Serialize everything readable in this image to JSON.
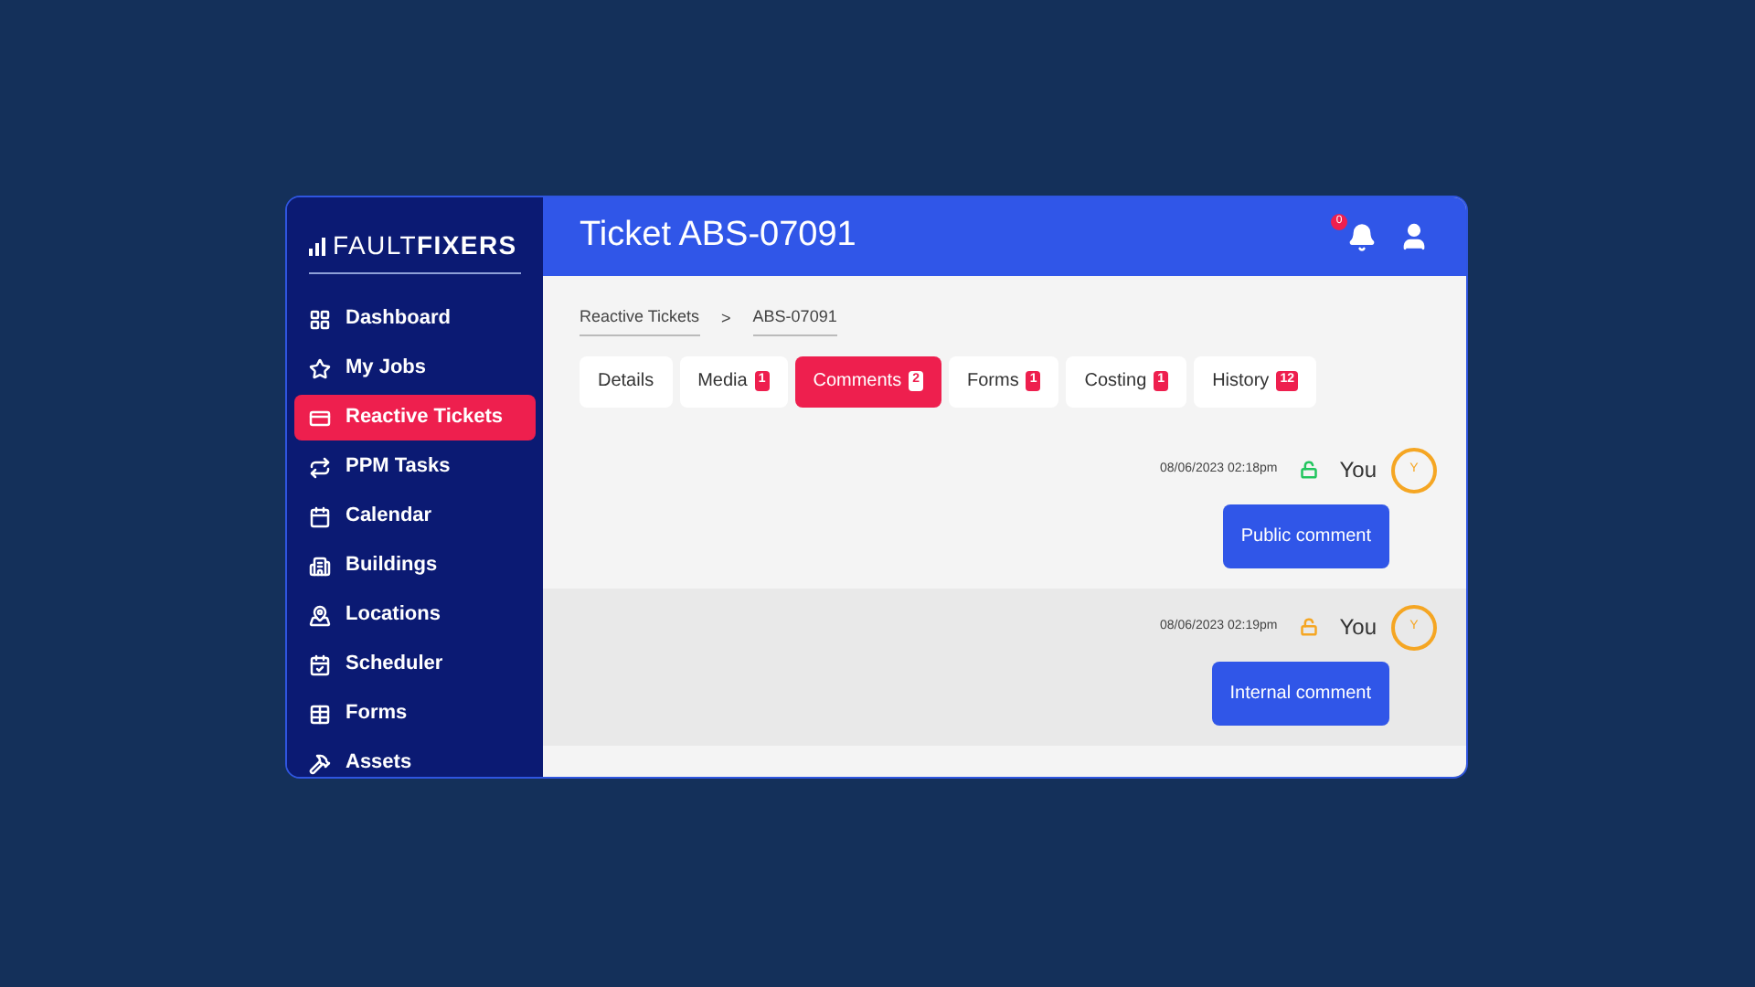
{
  "logo": "FAULT**FIXERS**",
  "sidebar": {
    "items": [
      {
        "label": "Dashboard",
        "selected": false
      },
      {
        "label": "My Jobs",
        "selected": false
      },
      {
        "label": "Reactive Tickets",
        "selected": true
      },
      {
        "label": "PPM Tasks",
        "selected": false
      },
      {
        "label": "Calendar",
        "selected": false
      },
      {
        "label": "Buildings",
        "selected": false
      },
      {
        "label": "Locations",
        "selected": false
      },
      {
        "label": "Scheduler",
        "selected": false
      },
      {
        "label": "Forms",
        "selected": false
      },
      {
        "label": "Assets",
        "selected": false
      }
    ]
  },
  "header": {
    "title": "Ticket ABS-07091",
    "notification_count": "0"
  },
  "breadcrumb": [
    "Reactive Tickets",
    "ABS-07091"
  ],
  "breadcrumb_separator": ">",
  "tabs": [
    {
      "label": "Details",
      "selected": false
    },
    {
      "label": "Media",
      "count": "1",
      "selected": false
    },
    {
      "label": "Comments",
      "count": "2",
      "selected": true
    },
    {
      "label": "Forms",
      "count": "1",
      "selected": false
    },
    {
      "label": "Costing",
      "count": "1",
      "selected": false
    },
    {
      "label": "History",
      "count": "12",
      "selected": false
    }
  ],
  "comments": [
    {
      "time": "08/06/2023 02:18pm",
      "kind": "public",
      "author": "You",
      "initial": "Y",
      "text": "Public comment"
    },
    {
      "time": "08/06/2023 02:19pm",
      "kind": "internal",
      "author": "You",
      "initial": "Y",
      "text": "Internal comment"
    }
  ]
}
